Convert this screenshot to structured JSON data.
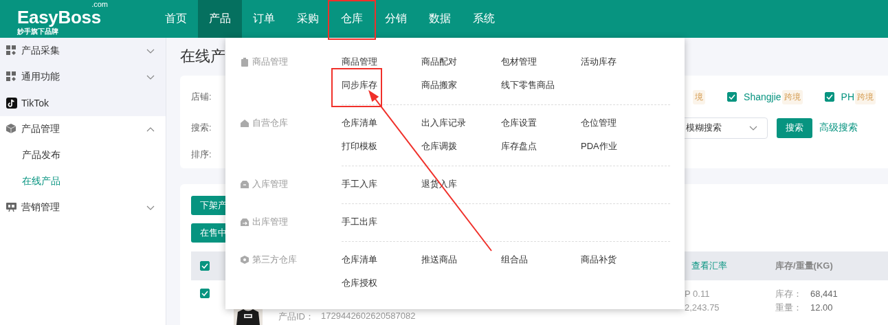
{
  "header": {
    "logo": {
      "name": "EasyBoss",
      "suffix": ".com",
      "tagline": "妙手旗下品牌"
    },
    "nav": [
      {
        "label": "首页",
        "selected": false,
        "highlighted": false
      },
      {
        "label": "产品",
        "selected": true,
        "highlighted": false
      },
      {
        "label": "订单",
        "selected": false,
        "highlighted": false
      },
      {
        "label": "采购",
        "selected": false,
        "highlighted": false
      },
      {
        "label": "仓库",
        "selected": false,
        "highlighted": true
      },
      {
        "label": "分销",
        "selected": false,
        "highlighted": false
      },
      {
        "label": "数据",
        "selected": false,
        "highlighted": false
      },
      {
        "label": "系统",
        "selected": false,
        "highlighted": false
      }
    ]
  },
  "sidebar": {
    "pinned": [
      {
        "label": "产品采集",
        "kind": "group",
        "expanded": false
      },
      {
        "label": "通用功能",
        "kind": "group",
        "expanded": false
      },
      {
        "label": "TikTok",
        "kind": "link"
      }
    ],
    "items": [
      {
        "label": "产品管理",
        "kind": "group",
        "expanded": true,
        "children": [
          {
            "label": "产品发布",
            "selected": false
          },
          {
            "label": "在线产品",
            "selected": true
          }
        ]
      },
      {
        "label": "营销管理",
        "kind": "group",
        "expanded": false
      }
    ]
  },
  "page_title": "在线产",
  "filters": {
    "shop_label": "店铺:",
    "search_label": "搜索:",
    "sort_label": "排序:",
    "shops": [
      {
        "tag": "境"
      },
      {
        "name": "Shangjie",
        "tag": "跨境",
        "checked": true
      },
      {
        "name": "PH",
        "tag": "跨境",
        "checked": true
      }
    ],
    "match_mode": "模糊搜索",
    "search_button": "搜索",
    "advanced_link": "高级搜索"
  },
  "actions": [
    "下架产",
    "在售中"
  ],
  "table": {
    "header_checked": true,
    "columns": [
      {
        "label": "查看汇率",
        "kind": "link"
      },
      {
        "label": "库存/重量(KG)",
        "kind": "text"
      }
    ],
    "rows": [
      {
        "selected": true,
        "product_id_label": "产品ID：",
        "product_id": "1729442602620587082",
        "price_1": "P 0.11",
        "price_2": "2,243.75",
        "stock_label": "库存：",
        "stock": "68,441",
        "weight_label": "重量：",
        "weight": "12.00"
      }
    ]
  },
  "menu": {
    "groups": [
      {
        "label": "商品管理",
        "items": [
          {
            "label": "商品管理",
            "highlighted": false
          },
          {
            "label": "商品配对",
            "highlighted": false
          },
          {
            "label": "包材管理",
            "highlighted": false
          },
          {
            "label": "活动库存",
            "highlighted": false
          },
          {
            "label": "同步库存",
            "highlighted": true
          },
          {
            "label": "商品搬家",
            "highlighted": false
          },
          {
            "label": "线下零售商品",
            "highlighted": false
          }
        ]
      },
      {
        "label": "自营仓库",
        "items": [
          {
            "label": "仓库清单",
            "highlighted": false
          },
          {
            "label": "出入库记录",
            "highlighted": false
          },
          {
            "label": "仓库设置",
            "highlighted": false
          },
          {
            "label": "仓位管理",
            "highlighted": false
          },
          {
            "label": "打印模板",
            "highlighted": false
          },
          {
            "label": "仓库调拨",
            "highlighted": false
          },
          {
            "label": "库存盘点",
            "highlighted": false
          },
          {
            "label": "PDA作业",
            "highlighted": false
          }
        ]
      },
      {
        "label": "入库管理",
        "items": [
          {
            "label": "手工入库",
            "highlighted": false
          },
          {
            "label": "退货入库",
            "highlighted": false
          }
        ]
      },
      {
        "label": "出库管理",
        "items": [
          {
            "label": "手工出库",
            "highlighted": false
          }
        ]
      },
      {
        "label": "第三方仓库",
        "items": [
          {
            "label": "仓库清单",
            "highlighted": false
          },
          {
            "label": "推送商品",
            "highlighted": false
          },
          {
            "label": "组合品",
            "highlighted": false
          },
          {
            "label": "商品补货",
            "highlighted": false
          },
          {
            "label": "仓库授权",
            "highlighted": false
          }
        ]
      }
    ]
  },
  "annotation_arrow": true
}
